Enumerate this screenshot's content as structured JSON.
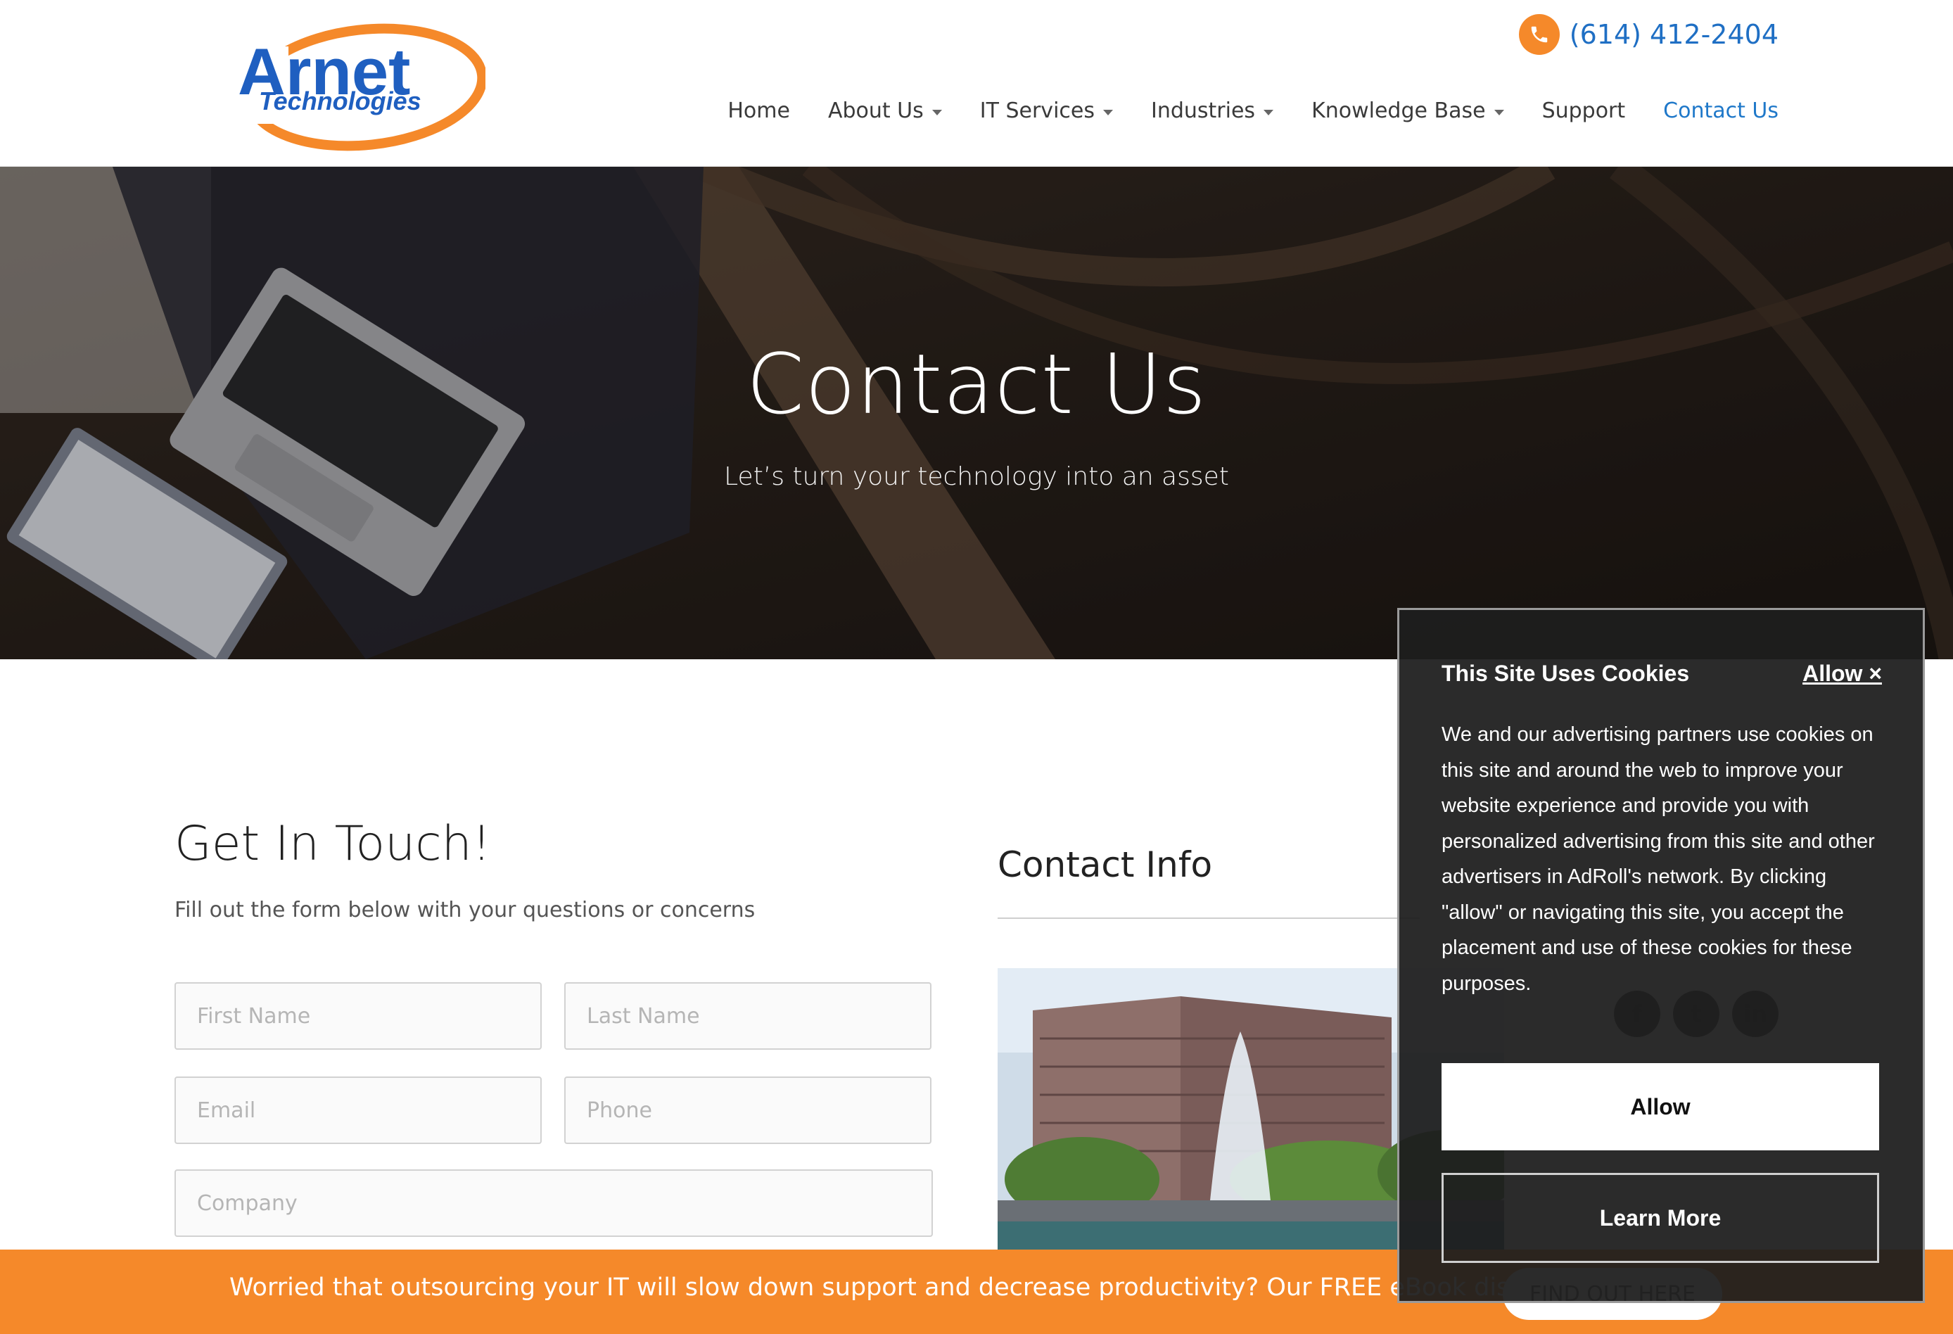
{
  "header": {
    "logo": {
      "line1": "Arnet",
      "line2": "Technologies"
    },
    "phone": "(614) 412-2404",
    "nav": [
      {
        "label": "Home",
        "dropdown": false
      },
      {
        "label": "About Us",
        "dropdown": true
      },
      {
        "label": "IT Services",
        "dropdown": true
      },
      {
        "label": "Industries",
        "dropdown": true
      },
      {
        "label": "Knowledge Base",
        "dropdown": true
      },
      {
        "label": "Support",
        "dropdown": false
      },
      {
        "label": "Contact Us",
        "dropdown": false,
        "active": true
      }
    ]
  },
  "hero": {
    "title": "Contact Us",
    "subtitle": "Let’s turn your technology into an asset"
  },
  "form": {
    "title": "Get In Touch!",
    "subtitle": "Fill out the form below with your questions or concerns",
    "first_name_placeholder": "First Name",
    "last_name_placeholder": "Last Name",
    "email_placeholder": "Email",
    "phone_placeholder": "Phone",
    "company_placeholder": "Company"
  },
  "contact_info": {
    "title": "Contact Info",
    "social": [
      "facebook-icon",
      "twitter-icon",
      "linkedin-icon"
    ]
  },
  "banner": {
    "text": "Worried that outsourcing your IT will slow down support and decrease productivity? Our FREE eBook disagrees",
    "button": "FIND OUT HERE"
  },
  "cookie": {
    "title": "This Site Uses Cookies",
    "close_label": "Allow ×",
    "body": "We and our advertising partners use cookies on this site and around the web to improve your website experience and provide you with personalized advertising from this site and other advertisers in AdRoll's network. By clicking \"allow\" or navigating this site, you accept the placement and use of these cookies for these purposes.",
    "allow_label": "Allow",
    "learn_more_label": "Learn More"
  },
  "colors": {
    "brand_orange": "#f5892a",
    "brand_blue": "#1f6fc4",
    "nav_active": "#1f78c9"
  }
}
